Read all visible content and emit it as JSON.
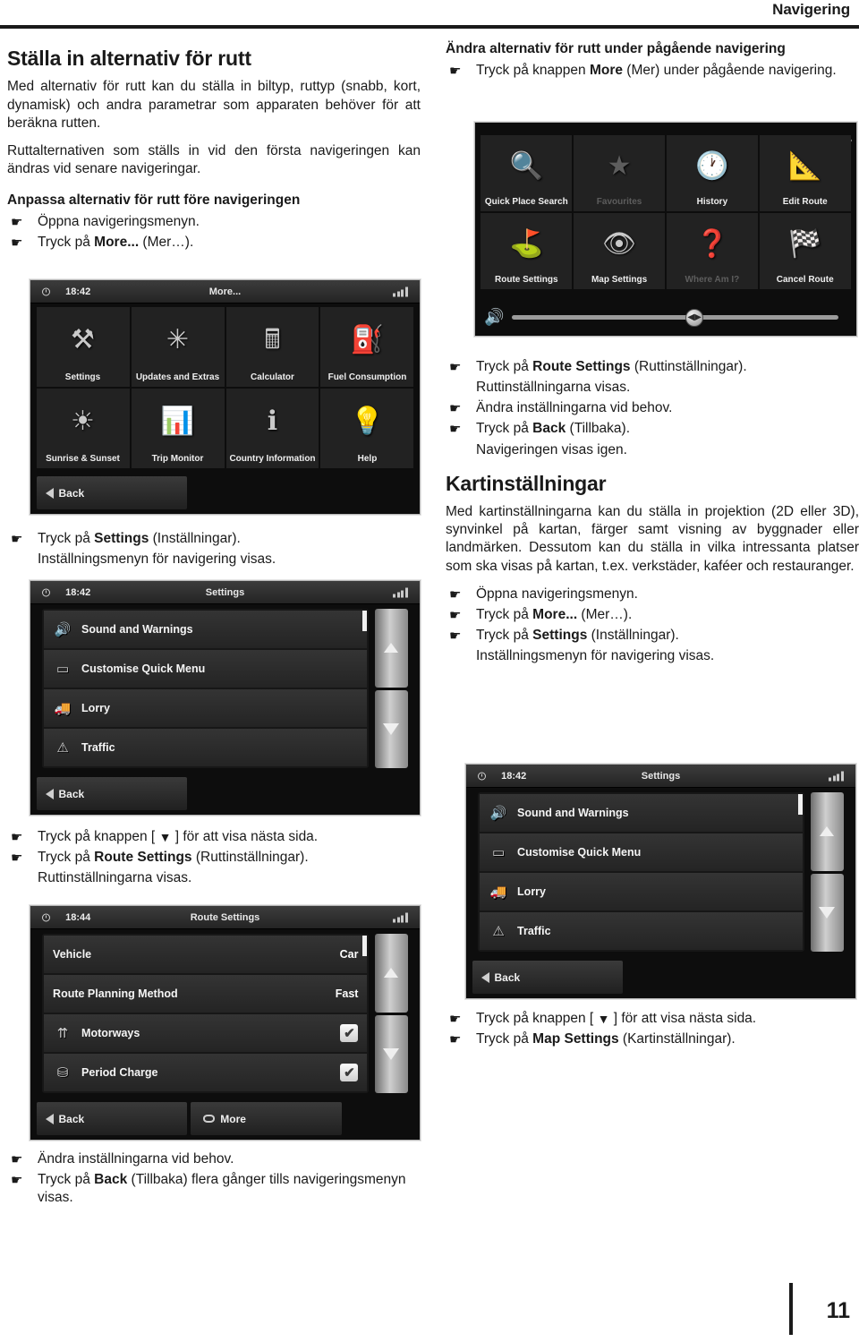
{
  "header": {
    "title": "Navigering"
  },
  "footer": {
    "page_number": "11"
  },
  "left_column": {
    "heading": "Ställa in alternativ för rutt",
    "paragraph1": "Med alternativ för rutt kan du ställa in biltyp, ruttyp (snabb, kort, dynamisk) och andra parametrar som apparaten behöver för att beräkna rutten.",
    "paragraph2": "Ruttalternativen som ställs in vid den första navigeringen kan ändras vid senare navigeringar.",
    "subheading": "Anpassa alternativ för rutt före navigeringen",
    "steps1": [
      {
        "type": "step",
        "text": "Öppna navigeringsmenyn."
      },
      {
        "type": "step",
        "pre": "Tryck på ",
        "bold": "More...",
        "post": " (Mer…)."
      }
    ],
    "steps2": [
      {
        "type": "step",
        "pre": "Tryck på ",
        "bold": "Settings",
        "post": " (Inställningar)."
      },
      {
        "type": "note",
        "text": "Inställningsmenyn för navigering visas."
      }
    ],
    "steps3": [
      {
        "type": "step",
        "pre": "Tryck på knappen [ ",
        "glyph": "▼",
        "post": " ] för att visa nästa sida."
      },
      {
        "type": "step",
        "pre": "Tryck på ",
        "bold": "Route Settings",
        "post": " (Ruttinställningar)."
      },
      {
        "type": "note",
        "text": "Ruttinställningarna visas."
      }
    ],
    "steps4": [
      {
        "type": "step",
        "text": "Ändra inställningarna vid behov."
      },
      {
        "type": "step",
        "pre": "Tryck på ",
        "bold": "Back",
        "post": " (Tillbaka) flera gånger tills navigeringsmenyn visas."
      }
    ]
  },
  "right_column": {
    "subheading": "Ändra alternativ för rutt under pågående navigering",
    "steps1": [
      {
        "type": "step",
        "pre": "Tryck på knappen ",
        "bold": "More",
        "post": " (Mer) under pågående navigering."
      }
    ],
    "steps2": [
      {
        "type": "step",
        "pre": "Tryck på ",
        "bold": "Route Settings",
        "post": " (Ruttinställningar)."
      },
      {
        "type": "note",
        "text": "Ruttinställningarna visas."
      },
      {
        "type": "step",
        "text": "Ändra inställningarna vid behov."
      },
      {
        "type": "step",
        "pre": "Tryck på ",
        "bold": "Back",
        "post": " (Tillbaka)."
      },
      {
        "type": "note",
        "text": "Navigeringen visas igen."
      }
    ],
    "heading": "Kartinställningar",
    "paragraph1": "Med kartinställningarna kan du ställa in projektion (2D eller 3D), synvinkel på kartan, färger samt visning av byggnader eller landmärken. Dessutom kan du ställa in vilka intressanta platser som ska visas på kartan, t.ex. verkstäder, kaféer och restauranger.",
    "steps3": [
      {
        "type": "step",
        "text": "Öppna navigeringsmenyn."
      },
      {
        "type": "step",
        "pre": "Tryck på ",
        "bold": "More...",
        "post": " (Mer…)."
      },
      {
        "type": "step",
        "pre": "Tryck på ",
        "bold": "Settings",
        "post": " (Inställningar)."
      },
      {
        "type": "note",
        "text": "Inställningsmenyn för navigering visas."
      }
    ],
    "steps4": [
      {
        "type": "step",
        "pre": "Tryck på knappen [ ",
        "glyph": "▼",
        "post": " ] för att visa nästa sida."
      },
      {
        "type": "step",
        "pre": "Tryck på ",
        "bold": "Map Settings",
        "post": " (Kartinställningar)."
      }
    ]
  },
  "screenshots": {
    "more_menu": {
      "time": "18:42",
      "title": "More...",
      "tiles": [
        {
          "label": "Settings",
          "icon": "tools-icon",
          "glyph": "⚒",
          "dim": false
        },
        {
          "label": "Updates and Extras",
          "icon": "updates-icon",
          "glyph": "✳",
          "dim": false
        },
        {
          "label": "Calculator",
          "icon": "calculator-icon",
          "glyph": "🖩",
          "dim": false
        },
        {
          "label": "Fuel Consumption",
          "icon": "fuel-can-icon",
          "glyph": "⛽",
          "dim": false
        },
        {
          "label": "Sunrise & Sunset",
          "icon": "sun-clock-icon",
          "glyph": "☀",
          "dim": false
        },
        {
          "label": "Trip Monitor",
          "icon": "bar-chart-icon",
          "glyph": "📊",
          "dim": false
        },
        {
          "label": "Country Information",
          "icon": "info-icon",
          "glyph": "ℹ",
          "dim": false
        },
        {
          "label": "Help",
          "icon": "lightbulb-icon",
          "glyph": "💡",
          "dim": false
        }
      ],
      "back_label": "Back"
    },
    "nav_menu": {
      "tiles": [
        {
          "label": "Quick Place Search",
          "icon": "magnifier-icon",
          "glyph": "🔍",
          "dim": false
        },
        {
          "label": "Favourites",
          "icon": "star-icon",
          "glyph": "★",
          "dim": true
        },
        {
          "label": "History",
          "icon": "clock-icon",
          "glyph": "🕐",
          "dim": false
        },
        {
          "label": "Edit Route",
          "icon": "ruler-icon",
          "glyph": "📐",
          "dim": false
        },
        {
          "label": "Route Settings",
          "icon": "signpost-icon",
          "glyph": "⛳",
          "dim": false
        },
        {
          "label": "Map Settings",
          "icon": "map-eye-icon",
          "glyph": "👁",
          "dim": false
        },
        {
          "label": "Where Am I?",
          "icon": "question-map-icon",
          "glyph": "❓",
          "dim": true
        },
        {
          "label": "Cancel Route",
          "icon": "checkered-flag-icon",
          "glyph": "🏁",
          "dim": false
        }
      ],
      "volume_icon": "speaker-icon",
      "next_page_icon": "chevron-right-icon"
    },
    "settings_menu": {
      "time": "18:42",
      "title": "Settings",
      "rows": [
        {
          "label": "Sound and Warnings",
          "icon": "sound-icon",
          "glyph": "🔊"
        },
        {
          "label": "Customise Quick Menu",
          "icon": "quick-menu-icon",
          "glyph": "▭"
        },
        {
          "label": "Lorry",
          "icon": "lorry-icon",
          "glyph": "🚚"
        },
        {
          "label": "Traffic",
          "icon": "traffic-warning-icon",
          "glyph": "⚠"
        }
      ],
      "back_label": "Back"
    },
    "route_settings": {
      "time": "18:44",
      "title": "Route Settings",
      "rows": [
        {
          "label": "Vehicle",
          "value": "Car",
          "icon": "",
          "glyph": ""
        },
        {
          "label": "Route Planning Method",
          "value": "Fast",
          "icon": "",
          "glyph": ""
        },
        {
          "label": "Motorways",
          "checked": true,
          "icon": "motorway-icon",
          "glyph": "⇈"
        },
        {
          "label": "Period Charge",
          "checked": true,
          "icon": "toll-icon",
          "glyph": "⛁"
        }
      ],
      "back_label": "Back",
      "more_label": "More"
    }
  }
}
